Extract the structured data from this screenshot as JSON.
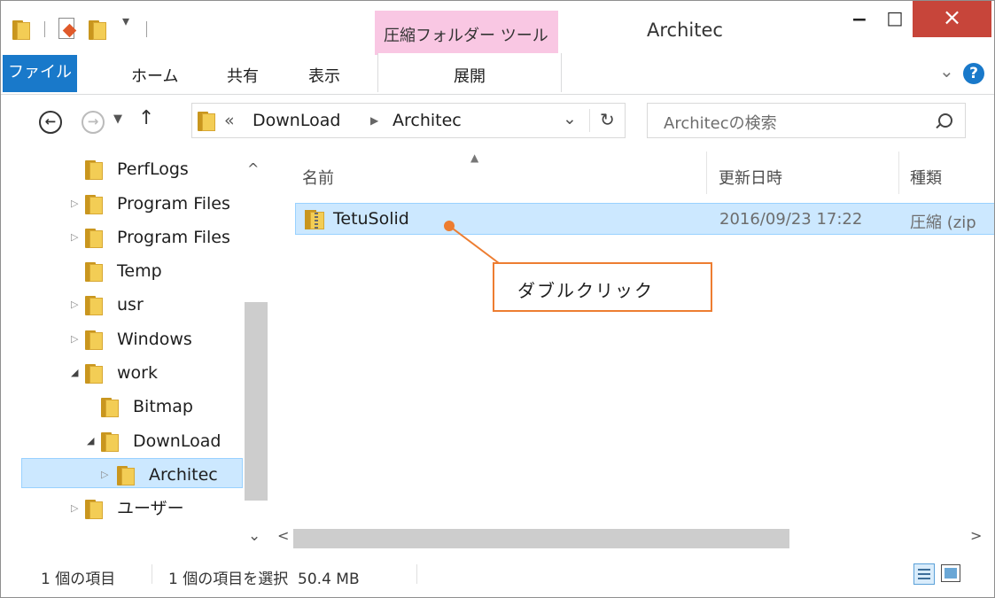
{
  "window": {
    "title": "Architec",
    "context_tab": "圧縮フォルダー ツール",
    "minimize": "−",
    "maximize": "□",
    "close": "×"
  },
  "ribbon": {
    "file": "ファイル",
    "tabs": [
      "ホーム",
      "共有",
      "表示"
    ],
    "context_tab": "展開",
    "help": "?",
    "expand": "⌄"
  },
  "address": {
    "prefix": "«",
    "path": [
      "DownLoad",
      "Architec"
    ],
    "search_placeholder": "Architecの検索"
  },
  "nav": {
    "items": [
      "PerfLogs",
      "Program Files",
      "Program Files",
      "Temp",
      "usr",
      "Windows",
      "work",
      "Bitmap",
      "DownLoad",
      "Architec",
      "ユーザー"
    ]
  },
  "columns": {
    "name": "名前",
    "modified": "更新日時",
    "type": "種類"
  },
  "files": [
    {
      "name": "TetuSolid",
      "modified": "2016/09/23 17:22",
      "type": "圧縮 (zip"
    }
  ],
  "annotation": {
    "text": "ダブルクリック"
  },
  "status": {
    "count": "1 個の項目",
    "selection": "1 個の項目を選択  50.4 MB"
  },
  "colors": {
    "close_button": "#c7453a",
    "file_tab": "#1979ca",
    "context_tab": "#f9c7e3",
    "selection": "#cce8ff",
    "annotation": "#ed7d31"
  }
}
